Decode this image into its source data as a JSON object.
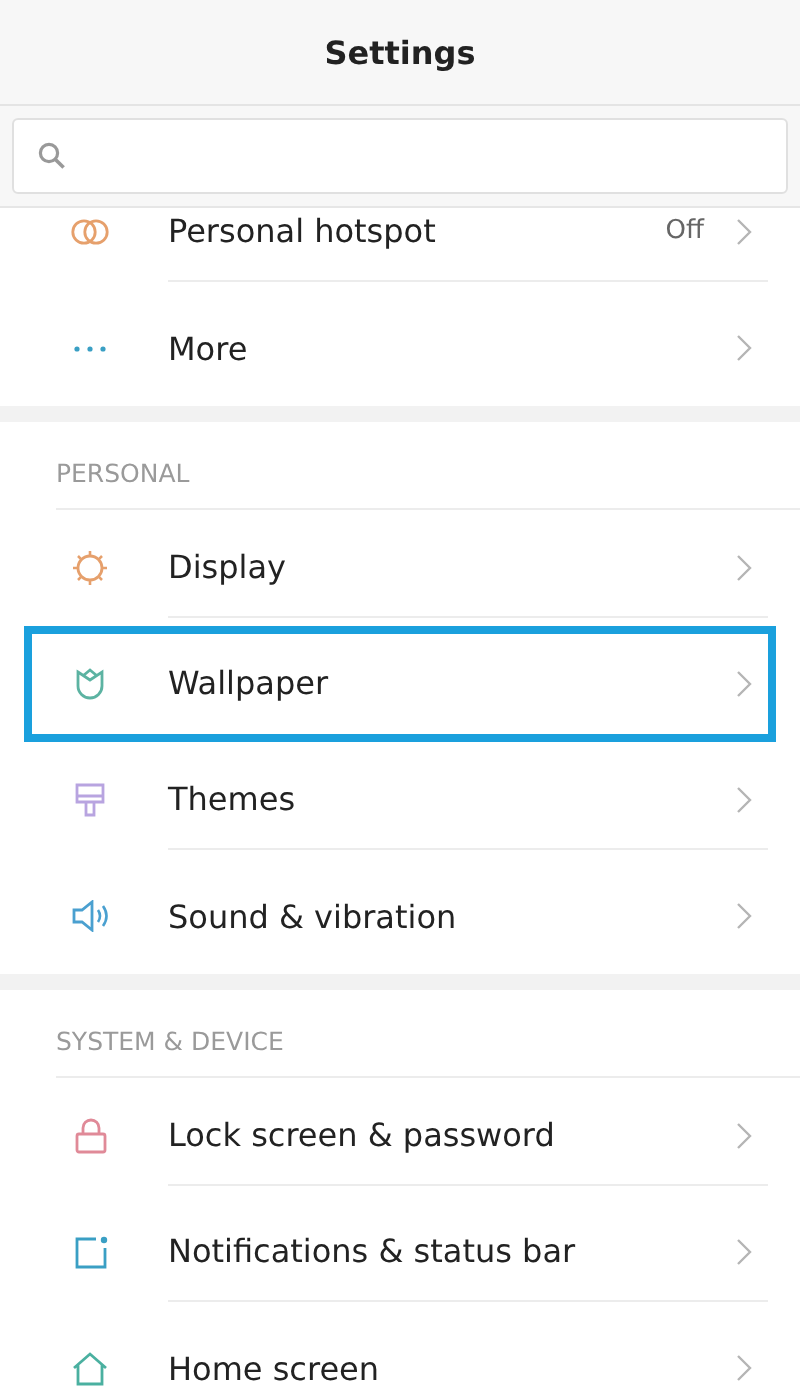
{
  "title": "Settings",
  "sections": [
    {
      "rows": [
        {
          "label": "Personal hotspot",
          "value": "Off",
          "highlighted": false
        },
        {
          "label": "More",
          "highlighted": false
        }
      ]
    },
    {
      "header": "PERSONAL",
      "rows": [
        {
          "label": "Display",
          "highlighted": false
        },
        {
          "label": "Wallpaper",
          "highlighted": true
        },
        {
          "label": "Themes",
          "highlighted": false
        },
        {
          "label": "Sound & vibration",
          "highlighted": false
        }
      ]
    },
    {
      "header": "SYSTEM & DEVICE",
      "rows": [
        {
          "label": "Lock screen & password",
          "highlighted": false
        },
        {
          "label": "Notifications & status bar",
          "highlighted": false
        },
        {
          "label": "Home screen",
          "highlighted": false
        }
      ]
    }
  ]
}
